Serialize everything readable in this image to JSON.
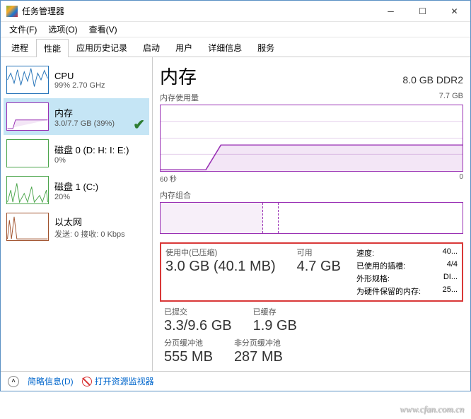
{
  "window": {
    "title": "任务管理器"
  },
  "menu": {
    "file": "文件(F)",
    "options": "选项(O)",
    "view": "查看(V)"
  },
  "tabs": [
    "进程",
    "性能",
    "应用历史记录",
    "启动",
    "用户",
    "详细信息",
    "服务"
  ],
  "active_tab_index": 1,
  "sidebar": [
    {
      "name": "CPU",
      "sub": "99% 2.70 GHz",
      "kind": "cpu"
    },
    {
      "name": "内存",
      "sub": "3.0/7.7 GB (39%)",
      "kind": "mem",
      "selected": true,
      "check": true
    },
    {
      "name": "磁盘 0 (D: H: I: E:)",
      "sub": "0%",
      "kind": "disk"
    },
    {
      "name": "磁盘 1 (C:)",
      "sub": "20%",
      "kind": "disk2"
    },
    {
      "name": "以太网",
      "sub": "发送: 0 接收: 0 Kbps",
      "kind": "eth"
    }
  ],
  "main": {
    "title": "内存",
    "capacity": "8.0 GB DDR2",
    "usage_label": "内存使用量",
    "max_label": "7.7 GB",
    "x_left": "60 秒",
    "x_right": "0",
    "composition_label": "内存组合",
    "stats": {
      "in_use_label": "使用中(已压缩)",
      "in_use_value": "3.0 GB (40.1 MB)",
      "available_label": "可用",
      "available_value": "4.7 GB",
      "committed_label": "已提交",
      "committed_value": "3.3/9.6 GB",
      "cached_label": "已缓存",
      "cached_value": "1.9 GB",
      "paged_label": "分页缓冲池",
      "paged_value": "555 MB",
      "nonpaged_label": "非分页缓冲池",
      "nonpaged_value": "287 MB"
    },
    "info": {
      "speed_label": "速度:",
      "speed_value": "40...",
      "slots_label": "已使用的插槽:",
      "slots_value": "4/4",
      "form_label": "外形规格:",
      "form_value": "DI...",
      "reserved_label": "为硬件保留的内存:",
      "reserved_value": "25..."
    }
  },
  "footer": {
    "fewer": "简略信息(D)",
    "monitor": "打开资源监视器"
  },
  "watermark": "www.cfan.com.cn",
  "chart_data": {
    "type": "area",
    "title": "内存使用量",
    "ylabel": "GB",
    "ylim": [
      0,
      7.7
    ],
    "xlabel": "秒",
    "xlim": [
      60,
      0
    ],
    "series": [
      {
        "name": "内存使用量",
        "approx_start_gb": 0.2,
        "approx_end_gb": 3.0,
        "transition_at_sec": 50
      }
    ]
  }
}
